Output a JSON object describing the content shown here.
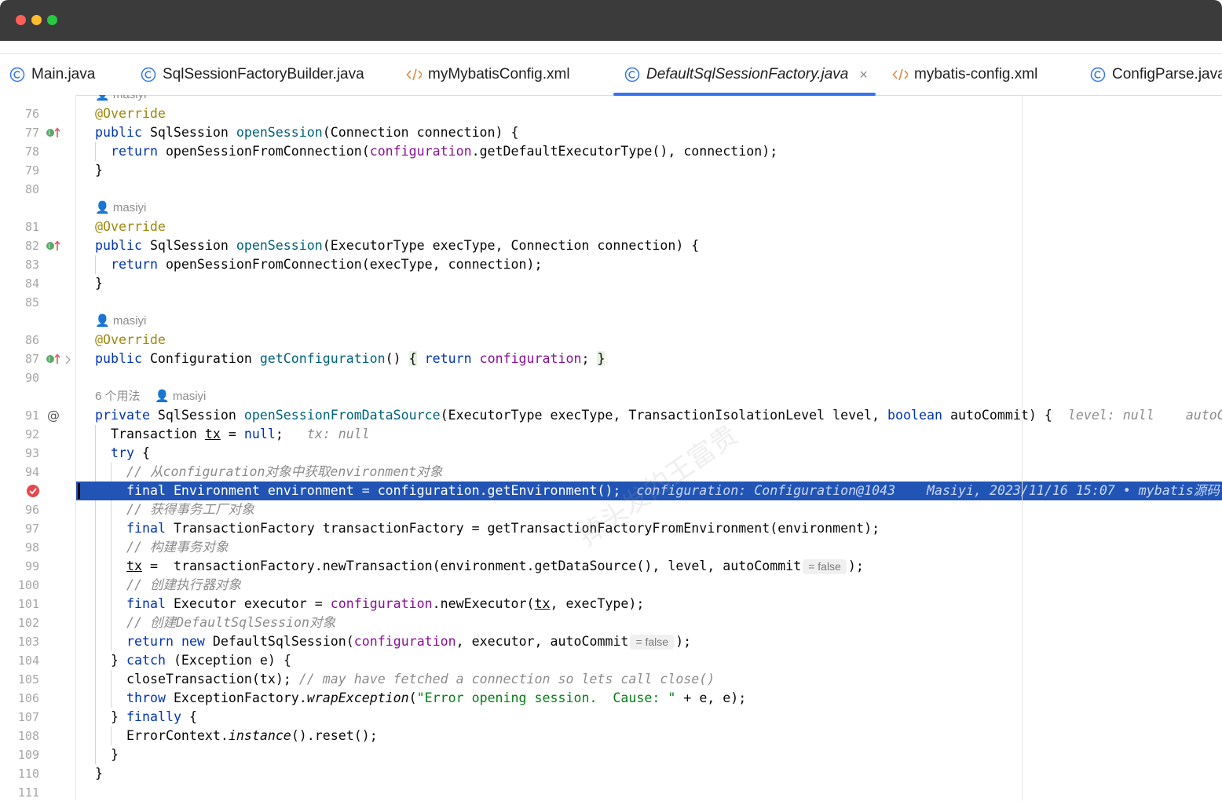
{
  "tabs": [
    {
      "label": "Main.java",
      "type": "class"
    },
    {
      "label": "SqlSessionFactoryBuilder.java",
      "type": "class"
    },
    {
      "label": "myMybatisConfig.xml",
      "type": "xml"
    },
    {
      "label": "DefaultSqlSessionFactory.java",
      "type": "class",
      "active": true
    },
    {
      "label": "mybatis-config.xml",
      "type": "xml"
    },
    {
      "label": "ConfigParse.java",
      "type": "class"
    }
  ],
  "tab_close": "×",
  "lines": {
    "l76": "76",
    "l77": "77",
    "l78": "78",
    "l79": "79",
    "l80": "80",
    "l81": "81",
    "l82": "82",
    "l83": "83",
    "l84": "84",
    "l85": "85",
    "l86": "86",
    "l87": "87",
    "l90": "90",
    "l91": "91",
    "l92": "92",
    "l93": "93",
    "l94": "94",
    "l96": "96",
    "l97": "97",
    "l98": "98",
    "l99": "99",
    "l100": "100",
    "l101": "101",
    "l102": "102",
    "l103": "103",
    "l104": "104",
    "l105": "105",
    "l106": "106",
    "l107": "107",
    "l108": "108",
    "l109": "109",
    "l110": "110",
    "l111": "111"
  },
  "author": "masiyi",
  "usages": "6 个用法",
  "code": {
    "override": "@Override",
    "public": "public",
    "private": "private",
    "return": "return",
    "final": "final",
    "try": "try",
    "catch": "catch",
    "finally": "finally",
    "throw": "throw",
    "new": "new",
    "null": "null",
    "boolean": "boolean",
    "sqlSession": " SqlSession ",
    "openSession": "openSession",
    "conn_sig": "(Connection connection) ",
    "lbrace": "{",
    "rbrace": "}",
    "ret1_a": " openSessionFromConnection(",
    "configuration": "configuration",
    "ret1_b": ".getDefaultExecutorType(), connection);",
    "exec_sig": "(ExecutorType execType, Connection connection) ",
    "ret2": " openSessionFromConnection(execType, connection);",
    "config_type": " Configuration ",
    "getConfiguration": "getConfiguration",
    "parens": "()",
    "semi": ";",
    "openSessionFromDataSource": "openSessionFromDataSource",
    "ds_sig_a": "(ExecutorType execType, TransactionIsolationLevel level, ",
    "ds_sig_b": " autoCommit) {",
    "hint_level": "level: null",
    "hint_auto": "autoCommit",
    "tx_decl": "Transaction ",
    "tx": "tx",
    "eq": " = ",
    "hint_tx": "tx: null",
    "c94": "// 从configuration对象中获取environment对象",
    "l95_a": "final Environment environment = configuration.getEnvironment();",
    "hint_95": "configuration: Configuration@1043",
    "blame_95": "Masiyi, 2023/11/16 15:07 • mybatis源码",
    "c96": "// 获得事务工厂对象",
    "l97": " TransactionFactory transactionFactory = getTransactionFactoryFromEnvironment(environment);",
    "c98": "// 构建事务对象",
    "l99_a": ".newTransaction(environment.getDataSource(), level, autoCommit",
    "transactionFactory": " transactionFactory",
    "inlay_false": "= false",
    "close_paren_semi": ");",
    "c100": "// 创建执行器对象",
    "l101_a": " Executor executor = ",
    "l101_b": ".newExecutor(",
    "l101_c": ", execType);",
    "c102": "// 创建DefaultSqlSession对象",
    "l103_a": " DefaultSqlSession(",
    "l103_b": ", executor, autoCommit",
    "exc_sig": " (Exception e) ",
    "l105_a": "closeTransaction(tx); ",
    "c105": "// may have fetched a connection so lets call close()",
    "l106_a": " ExceptionFactory.",
    "wrapException": "wrapException",
    "l106_str": "\"Error opening session.  Cause: \"",
    "l106_b": " + e, e);",
    "l108_a": "ErrorContext.",
    "instance": "instance",
    "l108_b": "().reset();"
  },
  "watermark": "掉头发的王富贵",
  "colors": {
    "selection": "#2154b5",
    "accent": "#3574f0"
  }
}
